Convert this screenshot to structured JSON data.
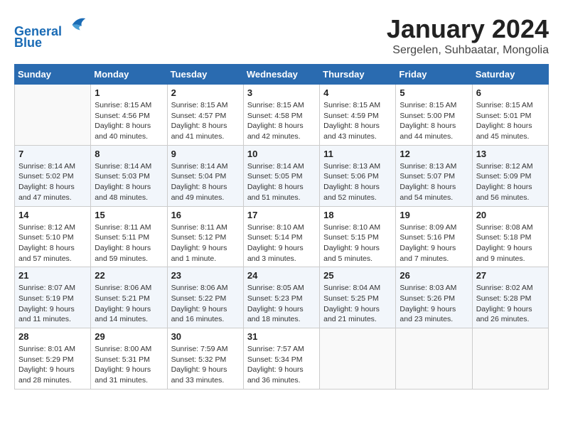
{
  "header": {
    "logo_line1": "General",
    "logo_line2": "Blue",
    "title": "January 2024",
    "subtitle": "Sergelen, Suhbaatar, Mongolia"
  },
  "days_of_week": [
    "Sunday",
    "Monday",
    "Tuesday",
    "Wednesday",
    "Thursday",
    "Friday",
    "Saturday"
  ],
  "weeks": [
    [
      {
        "day": "",
        "empty": true
      },
      {
        "day": "1",
        "sunrise": "Sunrise: 8:15 AM",
        "sunset": "Sunset: 4:56 PM",
        "daylight": "Daylight: 8 hours and 40 minutes."
      },
      {
        "day": "2",
        "sunrise": "Sunrise: 8:15 AM",
        "sunset": "Sunset: 4:57 PM",
        "daylight": "Daylight: 8 hours and 41 minutes."
      },
      {
        "day": "3",
        "sunrise": "Sunrise: 8:15 AM",
        "sunset": "Sunset: 4:58 PM",
        "daylight": "Daylight: 8 hours and 42 minutes."
      },
      {
        "day": "4",
        "sunrise": "Sunrise: 8:15 AM",
        "sunset": "Sunset: 4:59 PM",
        "daylight": "Daylight: 8 hours and 43 minutes."
      },
      {
        "day": "5",
        "sunrise": "Sunrise: 8:15 AM",
        "sunset": "Sunset: 5:00 PM",
        "daylight": "Daylight: 8 hours and 44 minutes."
      },
      {
        "day": "6",
        "sunrise": "Sunrise: 8:15 AM",
        "sunset": "Sunset: 5:01 PM",
        "daylight": "Daylight: 8 hours and 45 minutes."
      }
    ],
    [
      {
        "day": "7",
        "sunrise": "Sunrise: 8:14 AM",
        "sunset": "Sunset: 5:02 PM",
        "daylight": "Daylight: 8 hours and 47 minutes."
      },
      {
        "day": "8",
        "sunrise": "Sunrise: 8:14 AM",
        "sunset": "Sunset: 5:03 PM",
        "daylight": "Daylight: 8 hours and 48 minutes."
      },
      {
        "day": "9",
        "sunrise": "Sunrise: 8:14 AM",
        "sunset": "Sunset: 5:04 PM",
        "daylight": "Daylight: 8 hours and 49 minutes."
      },
      {
        "day": "10",
        "sunrise": "Sunrise: 8:14 AM",
        "sunset": "Sunset: 5:05 PM",
        "daylight": "Daylight: 8 hours and 51 minutes."
      },
      {
        "day": "11",
        "sunrise": "Sunrise: 8:13 AM",
        "sunset": "Sunset: 5:06 PM",
        "daylight": "Daylight: 8 hours and 52 minutes."
      },
      {
        "day": "12",
        "sunrise": "Sunrise: 8:13 AM",
        "sunset": "Sunset: 5:07 PM",
        "daylight": "Daylight: 8 hours and 54 minutes."
      },
      {
        "day": "13",
        "sunrise": "Sunrise: 8:12 AM",
        "sunset": "Sunset: 5:09 PM",
        "daylight": "Daylight: 8 hours and 56 minutes."
      }
    ],
    [
      {
        "day": "14",
        "sunrise": "Sunrise: 8:12 AM",
        "sunset": "Sunset: 5:10 PM",
        "daylight": "Daylight: 8 hours and 57 minutes."
      },
      {
        "day": "15",
        "sunrise": "Sunrise: 8:11 AM",
        "sunset": "Sunset: 5:11 PM",
        "daylight": "Daylight: 8 hours and 59 minutes."
      },
      {
        "day": "16",
        "sunrise": "Sunrise: 8:11 AM",
        "sunset": "Sunset: 5:12 PM",
        "daylight": "Daylight: 9 hours and 1 minute."
      },
      {
        "day": "17",
        "sunrise": "Sunrise: 8:10 AM",
        "sunset": "Sunset: 5:14 PM",
        "daylight": "Daylight: 9 hours and 3 minutes."
      },
      {
        "day": "18",
        "sunrise": "Sunrise: 8:10 AM",
        "sunset": "Sunset: 5:15 PM",
        "daylight": "Daylight: 9 hours and 5 minutes."
      },
      {
        "day": "19",
        "sunrise": "Sunrise: 8:09 AM",
        "sunset": "Sunset: 5:16 PM",
        "daylight": "Daylight: 9 hours and 7 minutes."
      },
      {
        "day": "20",
        "sunrise": "Sunrise: 8:08 AM",
        "sunset": "Sunset: 5:18 PM",
        "daylight": "Daylight: 9 hours and 9 minutes."
      }
    ],
    [
      {
        "day": "21",
        "sunrise": "Sunrise: 8:07 AM",
        "sunset": "Sunset: 5:19 PM",
        "daylight": "Daylight: 9 hours and 11 minutes."
      },
      {
        "day": "22",
        "sunrise": "Sunrise: 8:06 AM",
        "sunset": "Sunset: 5:21 PM",
        "daylight": "Daylight: 9 hours and 14 minutes."
      },
      {
        "day": "23",
        "sunrise": "Sunrise: 8:06 AM",
        "sunset": "Sunset: 5:22 PM",
        "daylight": "Daylight: 9 hours and 16 minutes."
      },
      {
        "day": "24",
        "sunrise": "Sunrise: 8:05 AM",
        "sunset": "Sunset: 5:23 PM",
        "daylight": "Daylight: 9 hours and 18 minutes."
      },
      {
        "day": "25",
        "sunrise": "Sunrise: 8:04 AM",
        "sunset": "Sunset: 5:25 PM",
        "daylight": "Daylight: 9 hours and 21 minutes."
      },
      {
        "day": "26",
        "sunrise": "Sunrise: 8:03 AM",
        "sunset": "Sunset: 5:26 PM",
        "daylight": "Daylight: 9 hours and 23 minutes."
      },
      {
        "day": "27",
        "sunrise": "Sunrise: 8:02 AM",
        "sunset": "Sunset: 5:28 PM",
        "daylight": "Daylight: 9 hours and 26 minutes."
      }
    ],
    [
      {
        "day": "28",
        "sunrise": "Sunrise: 8:01 AM",
        "sunset": "Sunset: 5:29 PM",
        "daylight": "Daylight: 9 hours and 28 minutes."
      },
      {
        "day": "29",
        "sunrise": "Sunrise: 8:00 AM",
        "sunset": "Sunset: 5:31 PM",
        "daylight": "Daylight: 9 hours and 31 minutes."
      },
      {
        "day": "30",
        "sunrise": "Sunrise: 7:59 AM",
        "sunset": "Sunset: 5:32 PM",
        "daylight": "Daylight: 9 hours and 33 minutes."
      },
      {
        "day": "31",
        "sunrise": "Sunrise: 7:57 AM",
        "sunset": "Sunset: 5:34 PM",
        "daylight": "Daylight: 9 hours and 36 minutes."
      },
      {
        "day": "",
        "empty": true
      },
      {
        "day": "",
        "empty": true
      },
      {
        "day": "",
        "empty": true
      }
    ]
  ]
}
